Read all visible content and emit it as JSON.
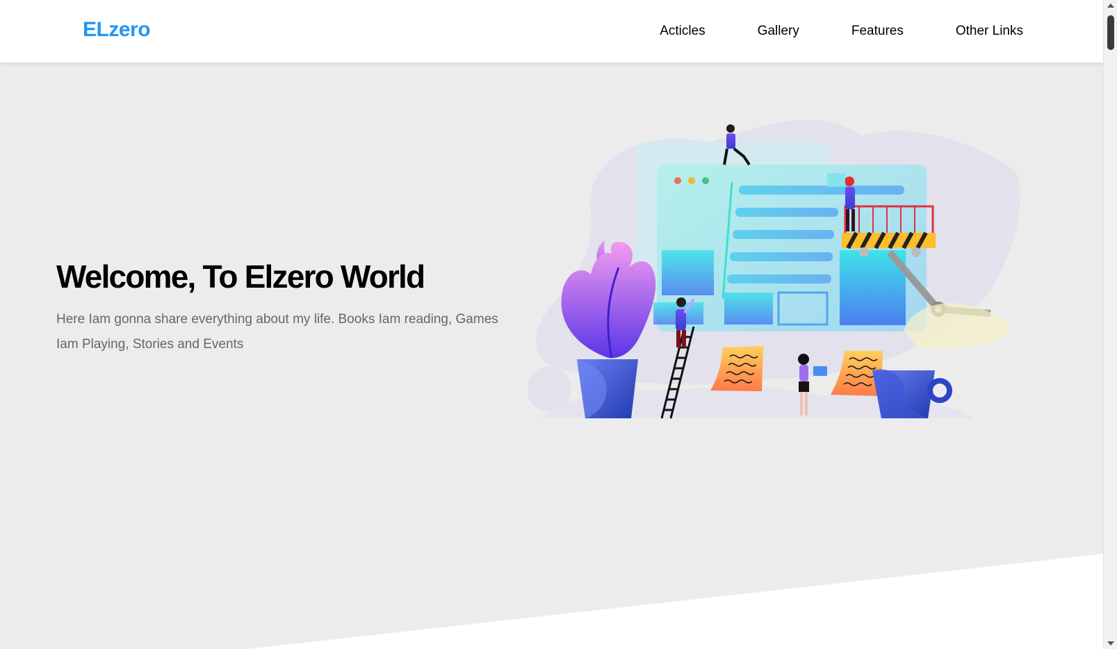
{
  "header": {
    "logo": "ELzero",
    "nav": [
      "Acticles",
      "Gallery",
      "Features",
      "Other Links"
    ]
  },
  "hero": {
    "title": "Welcome, To Elzero World",
    "description": "Here Iam gonna share everything about my life. Books Iam reading, Games Iam Playing, Stories and Events"
  },
  "colors": {
    "brand": "#2196f3",
    "background": "#ececec",
    "header_bg": "#ffffff"
  },
  "icons": [
    "landing-illustration"
  ]
}
